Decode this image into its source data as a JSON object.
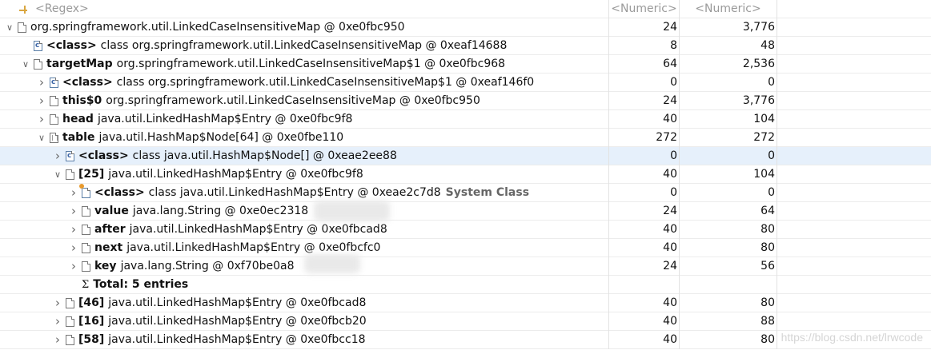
{
  "header": {
    "name": "<Regex>",
    "col1": "<Numeric>",
    "col2": "<Numeric>"
  },
  "rows": [
    {
      "indent": 0,
      "toggle": "expanded",
      "icon": "file-icon",
      "field": "",
      "type": "org.springframework.util.LinkedCaseInsensitiveMap @ 0xe0fbc950",
      "v1": "24",
      "v2": "3,776"
    },
    {
      "indent": 1,
      "toggle": "",
      "icon": "class-icon",
      "field": "<class>",
      "type": "class org.springframework.util.LinkedCaseInsensitiveMap @ 0xeaf14688",
      "v1": "8",
      "v2": "48"
    },
    {
      "indent": 1,
      "toggle": "expanded",
      "icon": "file-icon",
      "field": "targetMap",
      "type": "org.springframework.util.LinkedCaseInsensitiveMap$1 @ 0xe0fbc968",
      "v1": "64",
      "v2": "2,536"
    },
    {
      "indent": 2,
      "toggle": "collapsed",
      "icon": "class-icon",
      "field": "<class>",
      "type": "class org.springframework.util.LinkedCaseInsensitiveMap$1 @ 0xeaf146f0",
      "v1": "0",
      "v2": "0"
    },
    {
      "indent": 2,
      "toggle": "collapsed",
      "icon": "file-icon",
      "field": "this$0",
      "type": "org.springframework.util.LinkedCaseInsensitiveMap @ 0xe0fbc950",
      "v1": "24",
      "v2": "3,776"
    },
    {
      "indent": 2,
      "toggle": "collapsed",
      "icon": "file-icon",
      "field": "head",
      "type": "java.util.LinkedHashMap$Entry @ 0xe0fbc9f8",
      "v1": "40",
      "v2": "104"
    },
    {
      "indent": 2,
      "toggle": "expanded",
      "icon": "array-icon",
      "field": "table",
      "type": "java.util.HashMap$Node[64] @ 0xe0fbe110",
      "v1": "272",
      "v2": "272"
    },
    {
      "indent": 3,
      "toggle": "collapsed",
      "icon": "class-icon",
      "field": "<class>",
      "type": "class java.util.HashMap$Node[] @ 0xeae2ee88",
      "v1": "0",
      "v2": "0",
      "selected": true
    },
    {
      "indent": 3,
      "toggle": "expanded",
      "icon": "file-icon",
      "field": "[25]",
      "type": "java.util.LinkedHashMap$Entry @ 0xe0fbc9f8",
      "v1": "40",
      "v2": "104"
    },
    {
      "indent": 4,
      "toggle": "collapsed",
      "icon": "system-class-icon",
      "field": "<class>",
      "type": "class java.util.LinkedHashMap$Entry @ 0xeae2c7d8",
      "extra": "System Class",
      "v1": "0",
      "v2": "0"
    },
    {
      "indent": 4,
      "toggle": "collapsed",
      "icon": "file-icon",
      "field": "value",
      "type": "java.lang.String @ 0xe0ec2318",
      "v1": "24",
      "v2": "64"
    },
    {
      "indent": 4,
      "toggle": "collapsed",
      "icon": "file-icon",
      "field": "after",
      "type": "java.util.LinkedHashMap$Entry @ 0xe0fbcad8",
      "v1": "40",
      "v2": "80"
    },
    {
      "indent": 4,
      "toggle": "collapsed",
      "icon": "file-icon",
      "field": "next",
      "type": "java.util.LinkedHashMap$Entry @ 0xe0fbcfc0",
      "v1": "40",
      "v2": "80"
    },
    {
      "indent": 4,
      "toggle": "collapsed",
      "icon": "file-icon",
      "field": "key",
      "type": "java.lang.String @ 0xf70be0a8",
      "v1": "24",
      "v2": "56"
    },
    {
      "indent": 4,
      "toggle": "",
      "icon": "sigma-icon",
      "field": "Total: 5 entries",
      "type": "",
      "v1": "",
      "v2": ""
    },
    {
      "indent": 3,
      "toggle": "collapsed",
      "icon": "file-icon",
      "field": "[46]",
      "type": "java.util.LinkedHashMap$Entry @ 0xe0fbcad8",
      "v1": "40",
      "v2": "80"
    },
    {
      "indent": 3,
      "toggle": "collapsed",
      "icon": "file-icon",
      "field": "[16]",
      "type": "java.util.LinkedHashMap$Entry @ 0xe0fbcb20",
      "v1": "40",
      "v2": "88"
    },
    {
      "indent": 3,
      "toggle": "collapsed",
      "icon": "file-icon",
      "field": "[58]",
      "type": "java.util.LinkedHashMap$Entry @ 0xe0fbcc18",
      "v1": "40",
      "v2": "80"
    }
  ],
  "watermark": "https://blog.csdn.net/lrwcode"
}
